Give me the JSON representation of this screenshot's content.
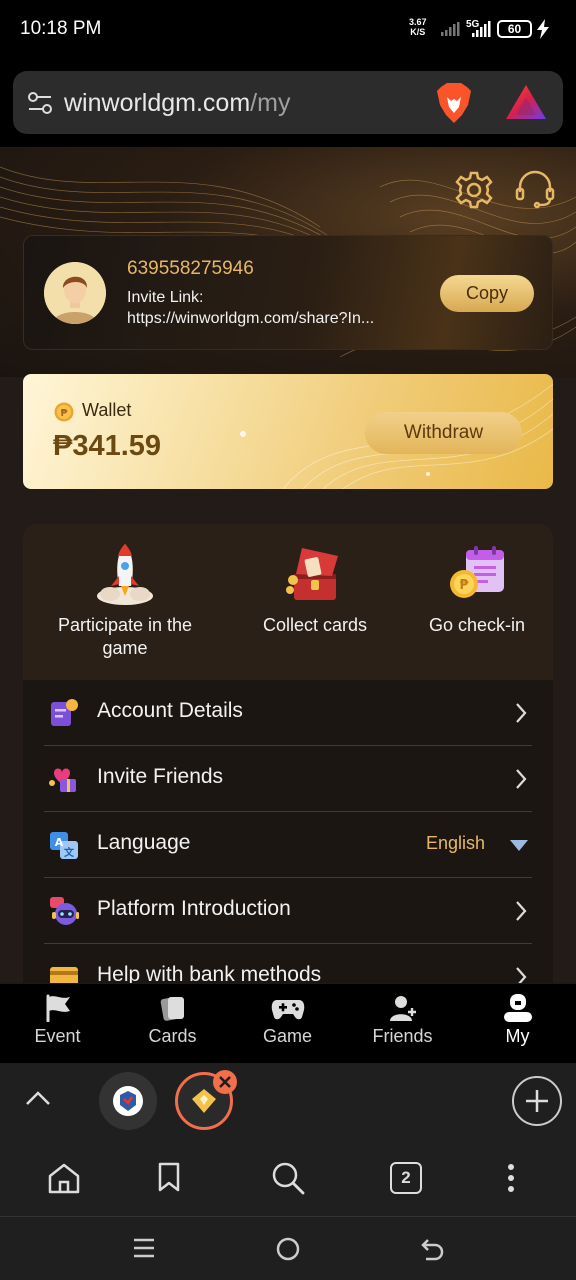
{
  "status_bar": {
    "time": "10:18 PM",
    "net_speed_value": "3.67",
    "net_speed_unit": "K/S",
    "network": "5G",
    "battery": "60"
  },
  "browser": {
    "url_domain": "winworldgm.com",
    "url_path": "/my",
    "tab_count": "2"
  },
  "profile": {
    "user_id": "639558275946",
    "invite_label": "Invite Link:",
    "invite_link": "https://winworldgm.com/share?In...",
    "copy_label": "Copy"
  },
  "wallet": {
    "label": "Wallet",
    "amount": "₱341.59",
    "withdraw_label": "Withdraw"
  },
  "quick_actions": [
    {
      "label": "Participate in the game",
      "icon": "rocket-icon"
    },
    {
      "label": "Collect cards",
      "icon": "treasure-chest-icon"
    },
    {
      "label": "Go check-in",
      "icon": "calendar-coin-icon"
    }
  ],
  "menu": [
    {
      "label": "Account Details",
      "icon": "account-book-icon"
    },
    {
      "label": "Invite Friends",
      "icon": "gift-heart-icon"
    },
    {
      "label": "Language",
      "icon": "translate-icon",
      "value": "English"
    },
    {
      "label": "Platform Introduction",
      "icon": "robot-chat-icon"
    },
    {
      "label": "Help with bank methods",
      "icon": "bank-card-icon"
    }
  ],
  "bottom_nav": [
    {
      "label": "Event",
      "icon": "flag-icon"
    },
    {
      "label": "Cards",
      "icon": "cards-icon"
    },
    {
      "label": "Game",
      "icon": "gamepad-icon"
    },
    {
      "label": "Friends",
      "icon": "add-friend-icon"
    },
    {
      "label": "My",
      "icon": "user-icon",
      "active": true
    }
  ],
  "colors": {
    "accent_gold": "#e6b866",
    "page_bg": "#231b17",
    "brave_orange": "#fb542b"
  }
}
